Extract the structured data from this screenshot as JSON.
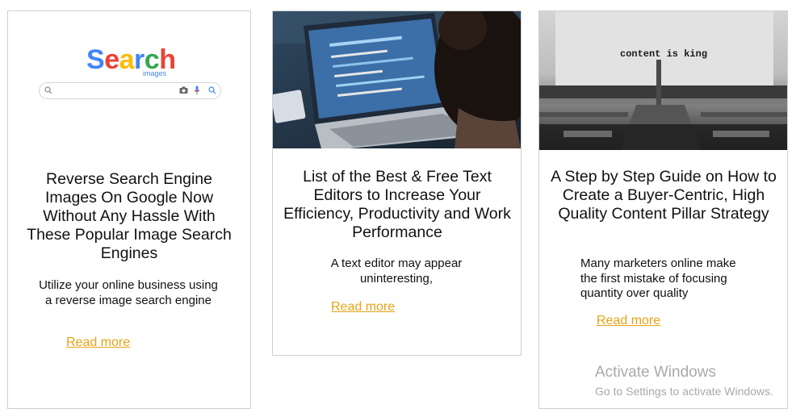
{
  "cards": [
    {
      "image": {
        "kind": "search-engine-illustration",
        "logo_letters": [
          "S",
          "e",
          "a",
          "r",
          "c",
          "h"
        ],
        "logo_colors": [
          "#4285F4",
          "#EA4335",
          "#FBBC05",
          "#4285F4",
          "#34A853",
          "#EA4335"
        ],
        "logo_subtitle": "images",
        "icons": [
          "search-icon",
          "camera-icon",
          "microphone-icon",
          "search-icon"
        ]
      },
      "title": "Reverse Search Engine Images On Google Now Without Any Hassle With These Popular Image Search Engines",
      "excerpt": "Utilize your online business using a reverse image search engine",
      "read_more": "Read more"
    },
    {
      "image": {
        "kind": "photo-laptop-code"
      },
      "title": "List of the Best & Free Text Editors to Increase Your Efficiency, Productivity and Work Performance",
      "excerpt": "A text editor may appear uninteresting,",
      "read_more": "Read more"
    },
    {
      "image": {
        "kind": "photo-typewriter",
        "caption": "content is king"
      },
      "title": "A Step by Step Guide on How to Create a Buyer-Centric, High Quality Content Pillar Strategy",
      "excerpt": "Many marketers online make the first mistake of focusing quantity over quality",
      "read_more": "Read more"
    }
  ],
  "colors": {
    "link": "#e8a317",
    "card_border": "#cfcfcf",
    "watermark": "#a9a9a9"
  },
  "watermark": {
    "title": "Activate Windows",
    "subtitle": "Go to Settings to activate Windows."
  }
}
